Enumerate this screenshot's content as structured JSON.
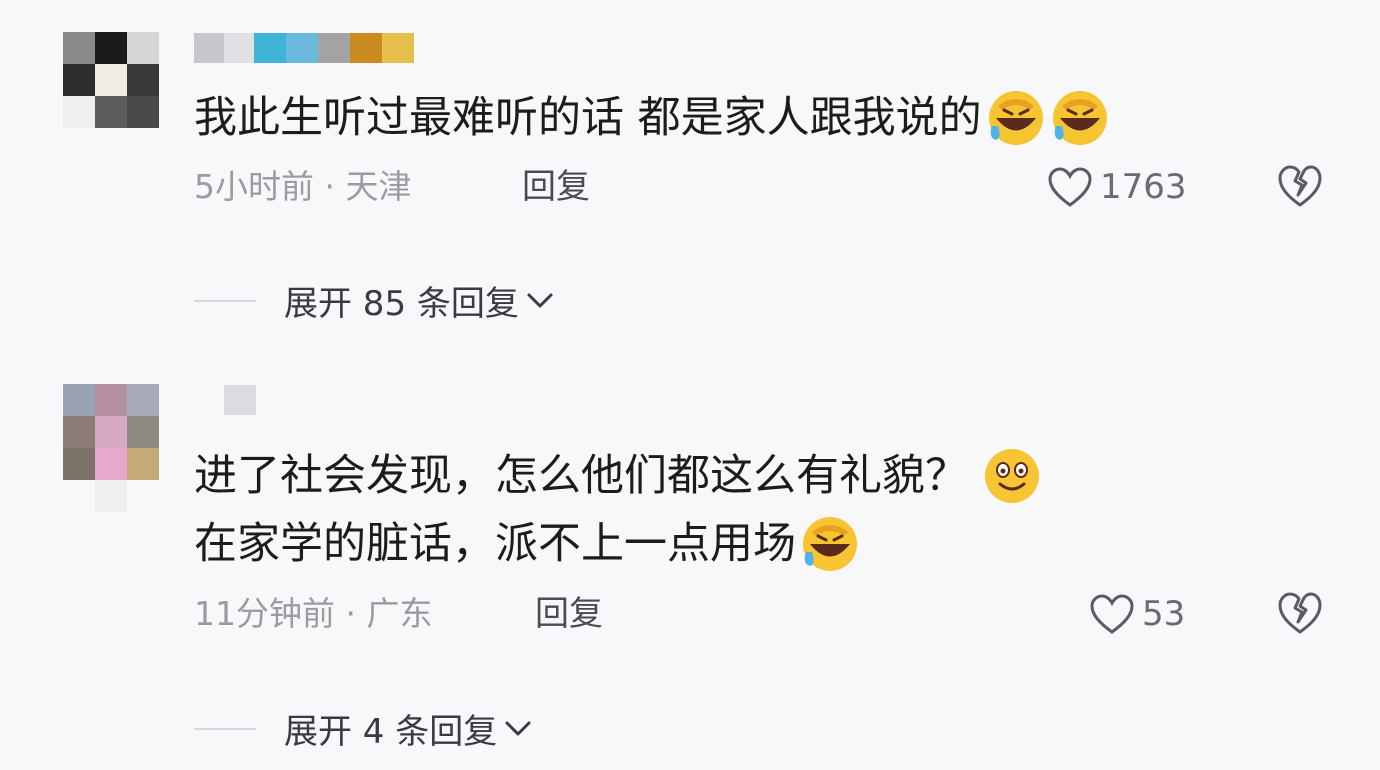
{
  "comments": [
    {
      "text_lines": [
        "我此生听过最难听的话 都是家人跟我说的"
      ],
      "time": "5小时前",
      "location": "天津",
      "meta": "5小时前 · 天津",
      "reply_label": "回复",
      "likes": "1763",
      "expand_label": "展开 85 条回复",
      "emojis": [
        "laughing-crying-emoji",
        "laughing-crying-emoji"
      ]
    },
    {
      "text_lines": [
        "进了社会发现，怎么他们都这么有礼貌？",
        "在家学的脏话，派不上一点用场"
      ],
      "time": "11分钟前",
      "location": "广东",
      "meta": "11分钟前 · 广东",
      "reply_label": "回复",
      "likes": "53",
      "expand_label": "展开 4 条回复",
      "emojis": [
        "smile-emoji",
        "laughing-crying-emoji"
      ]
    }
  ],
  "icons": {
    "like": "heart-outline-icon",
    "dislike": "broken-heart-icon",
    "expand": "chevron-down-icon"
  },
  "colors": {
    "background": "#f8f8fb",
    "text": "#1c1c1c",
    "meta": "#9b9ba1",
    "emoji_yellow": "#f7c531"
  }
}
